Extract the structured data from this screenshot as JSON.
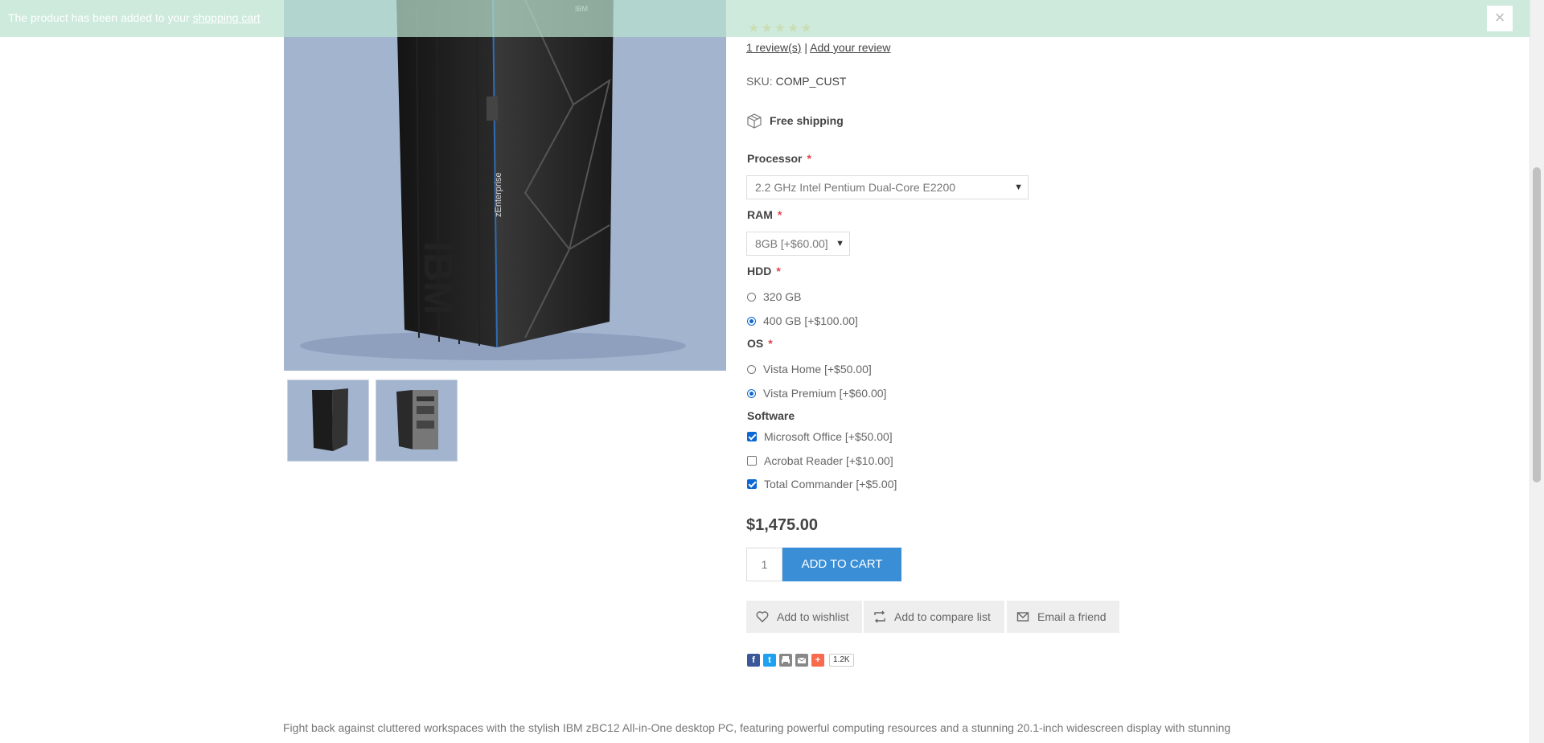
{
  "notification": {
    "message": "The product has been added to your",
    "link": "shopping cart",
    "close_glyph": "×"
  },
  "product": {
    "image_brand": "IBM",
    "image_model": "zEnterprise",
    "rating_stars": "★★★★★",
    "rating_value": 5,
    "reviews_link": "1 review(s)",
    "reviews_sep": "|",
    "add_review": "Add your review",
    "sku_label": "SKU:",
    "sku_value": "COMP_CUST",
    "shipping": "Free shipping",
    "price": "$1,475.00",
    "quantity": "1",
    "add_to_cart": "Add to cart"
  },
  "attributes": {
    "processor": {
      "label": "Processor",
      "value": "2.2 GHz Intel Pentium Dual-Core E2200"
    },
    "ram": {
      "label": "RAM",
      "value": "8GB [+$60.00]"
    },
    "hdd": {
      "label": "HDD",
      "options": [
        "320 GB",
        "400 GB [+$100.00]"
      ],
      "selected": 1
    },
    "os": {
      "label": "OS",
      "options": [
        "Vista Home [+$50.00]",
        "Vista Premium [+$60.00]"
      ],
      "selected": 1
    },
    "software": {
      "label": "Software",
      "options": [
        "Microsoft Office [+$50.00]",
        "Acrobat Reader [+$10.00]",
        "Total Commander [+$5.00]"
      ],
      "checked": [
        true,
        false,
        true
      ]
    },
    "required_mark": "*"
  },
  "actions": {
    "wishlist": "Add to wishlist",
    "compare": "Add to compare list",
    "email": "Email a friend"
  },
  "share": {
    "count": "1.2K",
    "facebook_glyph": "f",
    "twitter_glyph": "t",
    "plus_glyph": "+"
  },
  "description": {
    "line1": "Fight back against cluttered workspaces with the stylish IBM zBC12 All-in-One desktop PC, featuring powerful computing resources and a stunning 20.1-inch widescreen display with stunning"
  },
  "colors": {
    "accent": "#3a8ed6",
    "notify_bg": "#bae2ce",
    "image_bg": "#a3b4cf",
    "required": "#e4434b"
  }
}
